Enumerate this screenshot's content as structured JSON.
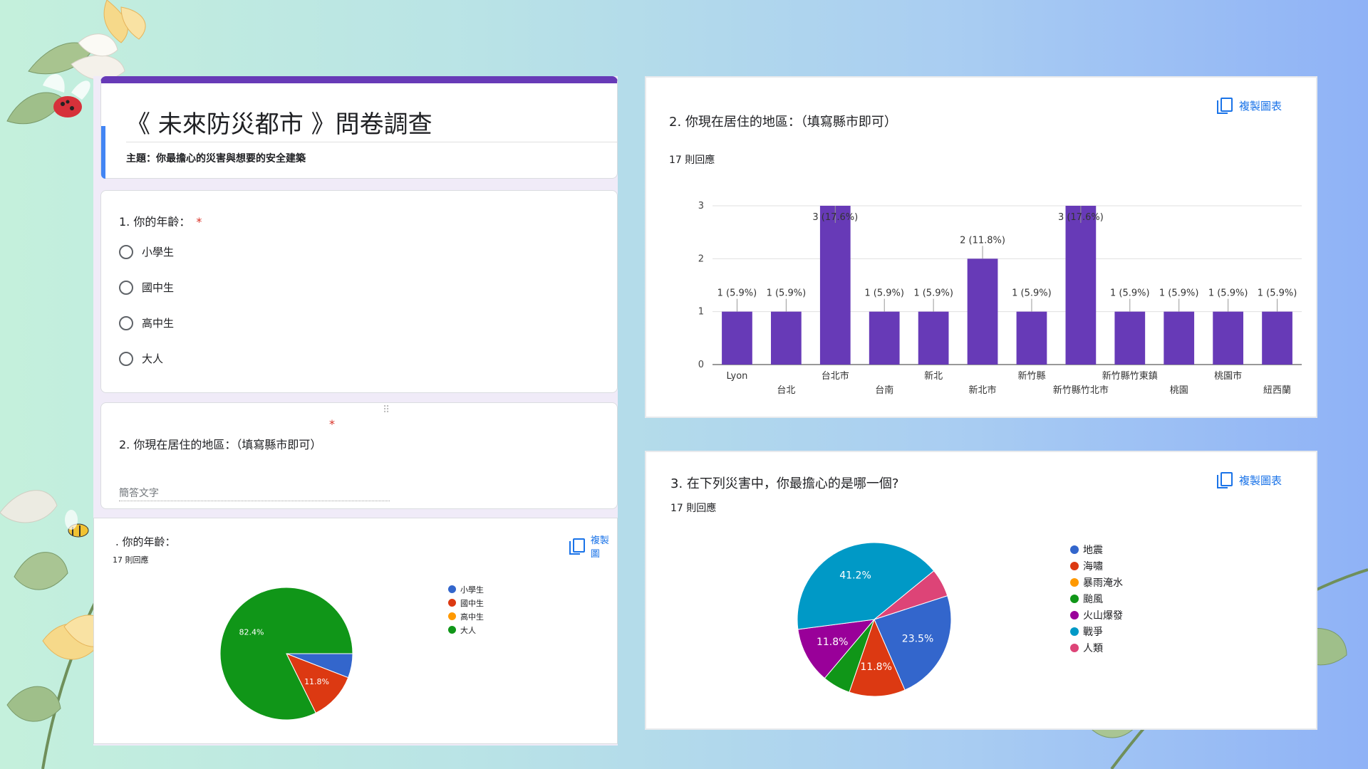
{
  "form": {
    "title": "《 未來防災都市 》問卷調查",
    "subtitle": "主題：你最擔心的災害與想要的安全建築",
    "q1": {
      "title": "1. 你的年齡：",
      "required_mark": "*",
      "options": [
        "小學生",
        "國中生",
        "高中生",
        "大人"
      ]
    },
    "q2": {
      "title": "2. 你現在居住的地區：（填寫縣市即可）",
      "required_mark": "*",
      "placeholder": "簡答文字"
    }
  },
  "age_chart": {
    "title": ". 你的年齡：",
    "responses": "17 則回應",
    "copy_label": "複製圖",
    "legend": [
      "小學生",
      "國中生",
      "高中生",
      "大人"
    ],
    "colors": [
      "#3366cc",
      "#dc3912",
      "#ff9900",
      "#109618"
    ]
  },
  "region_chart": {
    "title": "2. 你現在居住的地區：（填寫縣市即可）",
    "responses": "17 則回應",
    "copy_label": "複製圖表",
    "bar_color": "#673ab7"
  },
  "disaster_chart": {
    "title": "3.   在下列災害中，你最擔心的是哪一個?",
    "responses": "17 則回應",
    "copy_label": "複製圖表",
    "legend": [
      "地震",
      "海嘯",
      "暴雨淹水",
      "颱風",
      "火山爆發",
      "戰爭",
      "人類"
    ],
    "colors": [
      "#3366cc",
      "#dc3912",
      "#ff9900",
      "#109618",
      "#990099",
      "#0099c6",
      "#dd4477"
    ]
  },
  "chart_data": [
    {
      "type": "pie",
      "title": ". 你的年齡：",
      "categories": [
        "小學生",
        "國中生",
        "高中生",
        "大人"
      ],
      "values": [
        5.9,
        11.8,
        0,
        82.4
      ],
      "labels": [
        "",
        "11.8%",
        "",
        "82.4%"
      ]
    },
    {
      "type": "bar",
      "title": "2. 你現在居住的地區：（填寫縣市即可）",
      "categories": [
        "Lyon",
        "台北",
        "台北市",
        "台南",
        "新北",
        "新北市",
        "新竹縣",
        "新竹縣竹北市",
        "新竹縣竹東鎮",
        "桃園",
        "桃園市",
        "紐西蘭"
      ],
      "values": [
        1,
        1,
        3,
        1,
        1,
        2,
        1,
        3,
        1,
        1,
        1,
        1
      ],
      "labels": [
        "1 (5.9%)",
        "1 (5.9%)",
        "3 (17.6%)",
        "1 (5.9%)",
        "1 (5.9%)",
        "2 (11.8%)",
        "1 (5.9%)",
        "3 (17.6%)",
        "1 (5.9%)",
        "1 (5.9%)",
        "1 (5.9%)",
        "1 (5.9%)"
      ],
      "ylim": [
        0,
        3
      ],
      "yticks": [
        "0",
        "1",
        "2",
        "3"
      ]
    },
    {
      "type": "pie",
      "title": "3.   在下列災害中，你最擔心的是哪一個?",
      "categories": [
        "地震",
        "海嘯",
        "暴雨淹水",
        "颱風",
        "火山爆發",
        "戰爭",
        "人類"
      ],
      "values": [
        23.5,
        11.8,
        0,
        5.9,
        11.8,
        41.2,
        5.9
      ],
      "labels": [
        "23.5%",
        "11.8%",
        "",
        "",
        "11.8%",
        "41.2%",
        ""
      ]
    }
  ]
}
